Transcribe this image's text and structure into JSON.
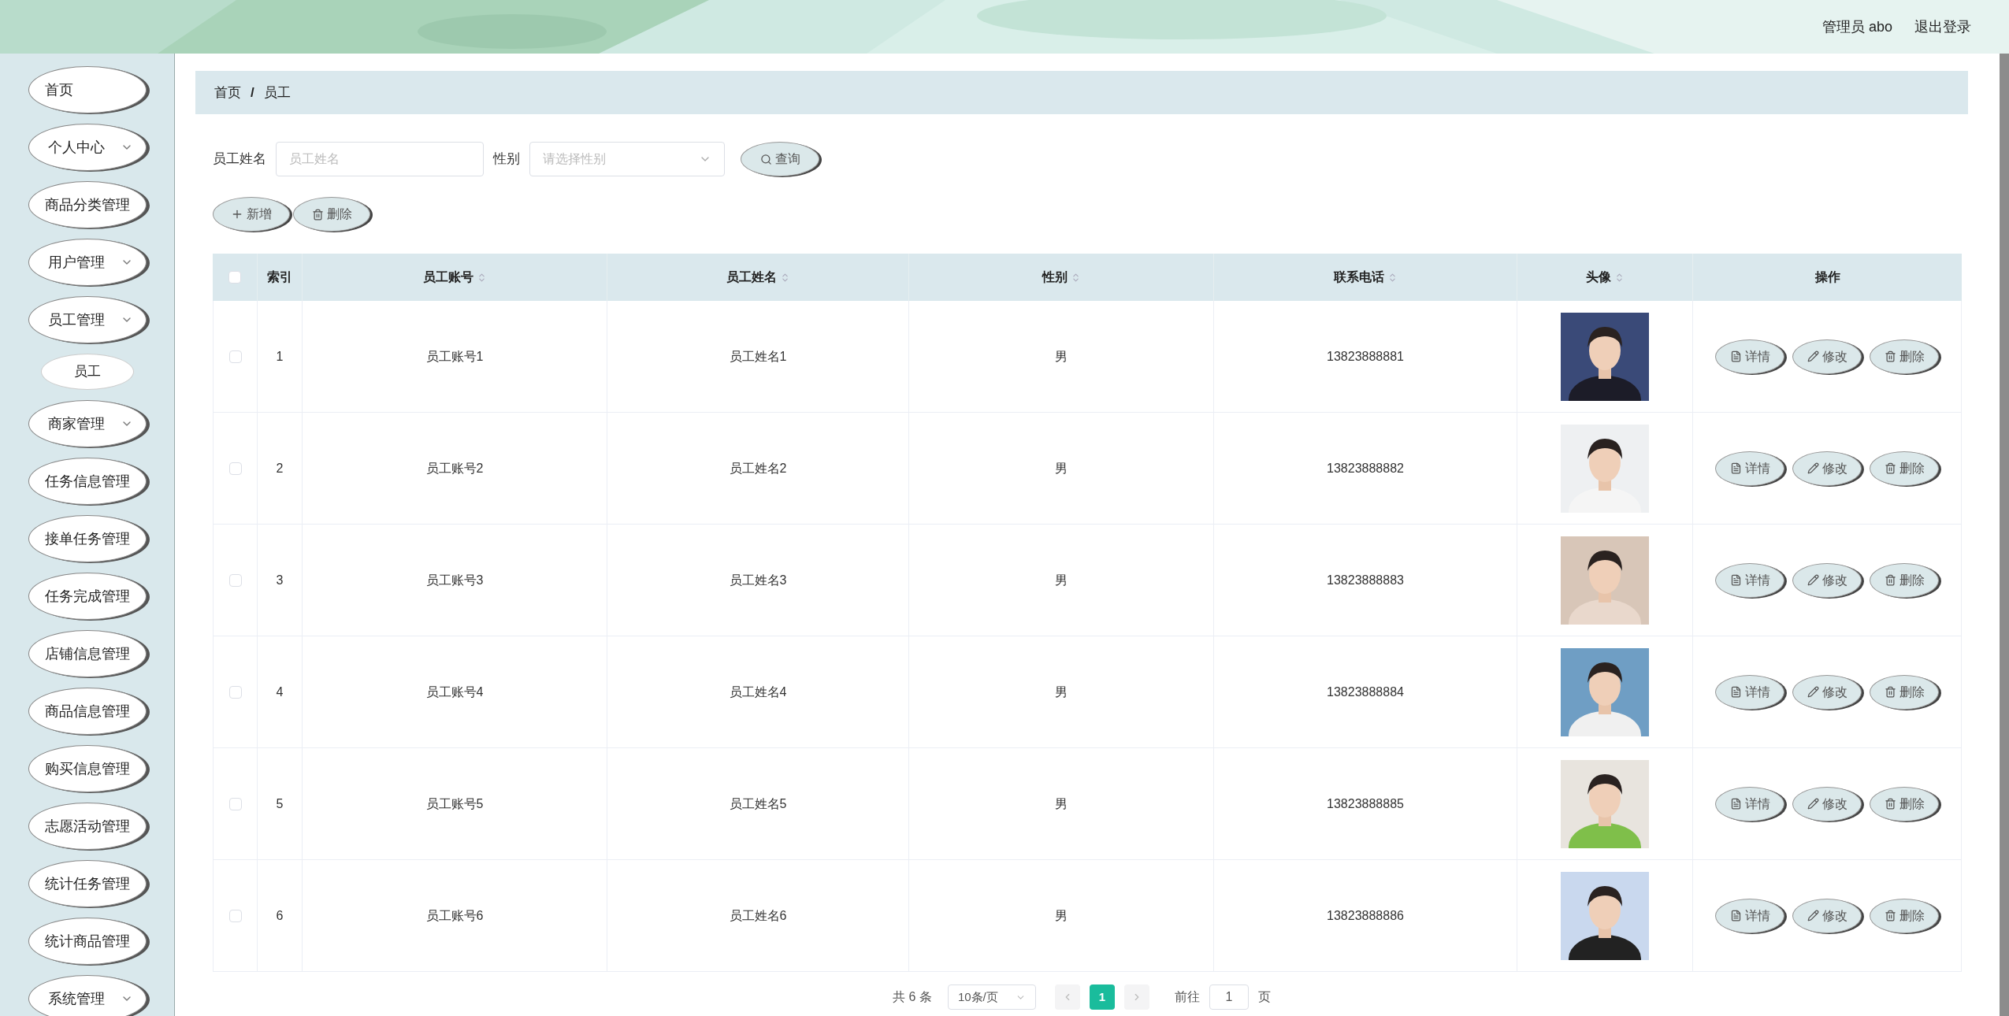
{
  "header": {
    "user_label": "管理员 abo",
    "logout": "退出登录"
  },
  "sidebar": {
    "items": [
      {
        "label": "首页",
        "expandable": false
      },
      {
        "label": "个人中心",
        "expandable": true
      },
      {
        "label": "商品分类管理",
        "expandable": false
      },
      {
        "label": "用户管理",
        "expandable": true
      },
      {
        "label": "员工管理",
        "expandable": true,
        "children": [
          {
            "label": "员工"
          }
        ]
      },
      {
        "label": "商家管理",
        "expandable": true
      },
      {
        "label": "任务信息管理",
        "expandable": false
      },
      {
        "label": "接单任务管理",
        "expandable": false
      },
      {
        "label": "任务完成管理",
        "expandable": false
      },
      {
        "label": "店铺信息管理",
        "expandable": false
      },
      {
        "label": "商品信息管理",
        "expandable": false
      },
      {
        "label": "购买信息管理",
        "expandable": false
      },
      {
        "label": "志愿活动管理",
        "expandable": false
      },
      {
        "label": "统计任务管理",
        "expandable": false
      },
      {
        "label": "统计商品管理",
        "expandable": false
      },
      {
        "label": "系统管理",
        "expandable": true
      }
    ]
  },
  "breadcrumb": {
    "items": [
      "首页",
      "员工"
    ],
    "separator": "/"
  },
  "search": {
    "fields": [
      {
        "label": "员工姓名",
        "placeholder": "员工姓名",
        "kind": "text"
      },
      {
        "label": "性别",
        "placeholder": "请选择性别",
        "kind": "select"
      }
    ],
    "button": "查询"
  },
  "toolbar": [
    {
      "label": "新增",
      "kind": "add"
    },
    {
      "label": "删除",
      "kind": "delete"
    }
  ],
  "table": {
    "select_all_checked": false,
    "columns": [
      {
        "label": "索引",
        "sortable": false
      },
      {
        "label": "员工账号",
        "sortable": true
      },
      {
        "label": "员工姓名",
        "sortable": true
      },
      {
        "label": "性别",
        "sortable": true
      },
      {
        "label": "联系电话",
        "sortable": true
      },
      {
        "label": "头像",
        "sortable": true
      },
      {
        "label": "操作",
        "sortable": false
      }
    ],
    "rows": [
      {
        "checked": false,
        "index": "1",
        "account": "员工账号1",
        "name": "员工姓名1",
        "gender": "男",
        "phone": "13823888881",
        "actions": [
          {
            "label": "详情",
            "kind": "detail"
          },
          {
            "label": "修改",
            "kind": "edit"
          },
          {
            "label": "删除",
            "kind": "delete"
          }
        ]
      },
      {
        "checked": false,
        "index": "2",
        "account": "员工账号2",
        "name": "员工姓名2",
        "gender": "男",
        "phone": "13823888882",
        "actions": [
          {
            "label": "详情",
            "kind": "detail"
          },
          {
            "label": "修改",
            "kind": "edit"
          },
          {
            "label": "删除",
            "kind": "delete"
          }
        ]
      },
      {
        "checked": false,
        "index": "3",
        "account": "员工账号3",
        "name": "员工姓名3",
        "gender": "男",
        "phone": "13823888883",
        "actions": [
          {
            "label": "详情",
            "kind": "detail"
          },
          {
            "label": "修改",
            "kind": "edit"
          },
          {
            "label": "删除",
            "kind": "delete"
          }
        ]
      },
      {
        "checked": false,
        "index": "4",
        "account": "员工账号4",
        "name": "员工姓名4",
        "gender": "男",
        "phone": "13823888884",
        "actions": [
          {
            "label": "详情",
            "kind": "detail"
          },
          {
            "label": "修改",
            "kind": "edit"
          },
          {
            "label": "删除",
            "kind": "delete"
          }
        ]
      },
      {
        "checked": false,
        "index": "5",
        "account": "员工账号5",
        "name": "员工姓名5",
        "gender": "男",
        "phone": "13823888885",
        "actions": [
          {
            "label": "详情",
            "kind": "detail"
          },
          {
            "label": "修改",
            "kind": "edit"
          },
          {
            "label": "删除",
            "kind": "delete"
          }
        ]
      },
      {
        "checked": false,
        "index": "6",
        "account": "员工账号6",
        "name": "员工姓名6",
        "gender": "男",
        "phone": "13823888886",
        "actions": [
          {
            "label": "详情",
            "kind": "detail"
          },
          {
            "label": "修改",
            "kind": "edit"
          },
          {
            "label": "删除",
            "kind": "delete"
          }
        ]
      }
    ]
  },
  "pagination": {
    "total": "共 6 条",
    "page_size": "10条/页",
    "pages": [
      {
        "label": "1",
        "selected": true
      }
    ],
    "goto_label": "前往",
    "goto_value": "1",
    "page_suffix": "页"
  }
}
